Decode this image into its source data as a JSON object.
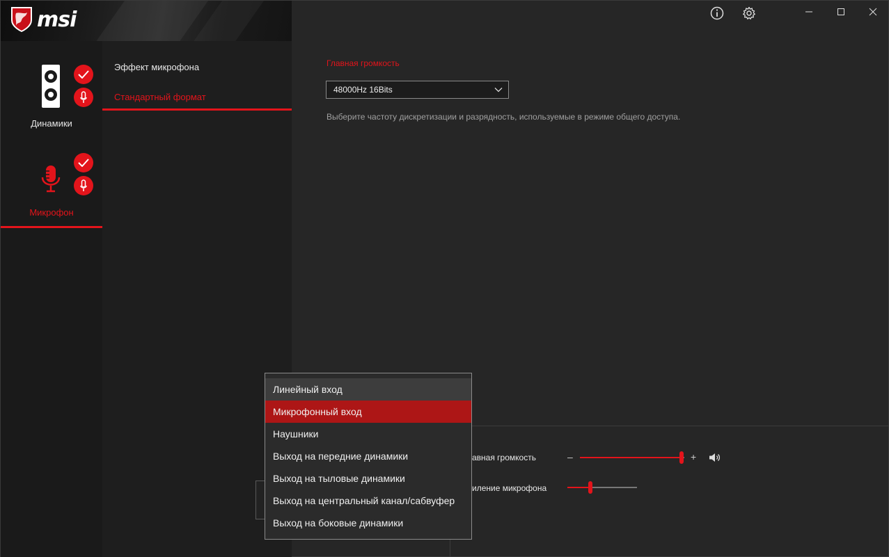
{
  "app": {
    "brand": "msi"
  },
  "colors": {
    "accent": "#e3141b",
    "background": "#262626",
    "sidebar": "#1a1a1a",
    "selected": "#ad1616"
  },
  "titlebar": {
    "icons": [
      "info-icon",
      "gear-icon"
    ],
    "window_controls": [
      "minimize-icon",
      "maximize-icon",
      "close-icon"
    ]
  },
  "sidebar": {
    "devices": [
      {
        "label": "Динамики",
        "active": false
      },
      {
        "label": "Микрофон",
        "active": true
      }
    ]
  },
  "subnav": {
    "items": [
      {
        "label": "Эффект микрофона",
        "active": false
      },
      {
        "label": "Стандартный формат",
        "active": true
      }
    ]
  },
  "main": {
    "section_title": "Главная громкость",
    "format_select": {
      "value": "48000Hz 16Bits"
    },
    "hint": "Выберите частоту дискретизации и разрядность, используемые в режиме общего доступа."
  },
  "bottom": {
    "main_volume": {
      "label": "авная громкость",
      "minus": "–",
      "plus": "+",
      "value_fraction": 0.97
    },
    "mic_gain": {
      "label": "иление микрофона",
      "value_fraction": 0.33
    }
  },
  "dropdown": {
    "items": [
      {
        "label": "Линейный вход",
        "state": "hover"
      },
      {
        "label": "Микрофонный вход",
        "state": "selected"
      },
      {
        "label": "Наушники",
        "state": ""
      },
      {
        "label": "Выход на передние динамики",
        "state": ""
      },
      {
        "label": "Выход на тыловые динамики",
        "state": ""
      },
      {
        "label": "Выход на центральный канал/сабвуфер",
        "state": ""
      },
      {
        "label": "Выход на боковые динамики",
        "state": ""
      }
    ]
  }
}
